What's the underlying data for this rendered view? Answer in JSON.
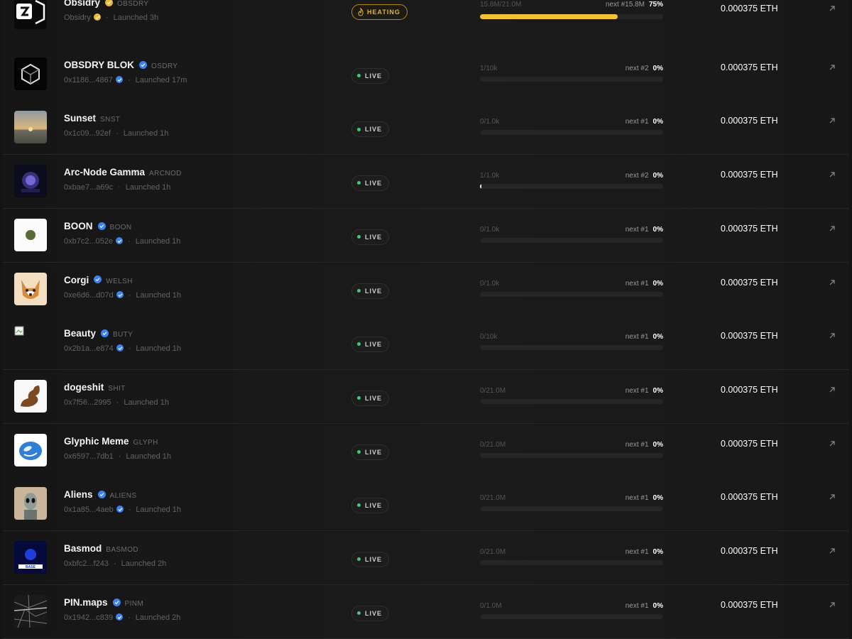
{
  "colors": {
    "live": "#3ecb74",
    "heating": "#e5b530",
    "verified": "#3b82f6",
    "progress": "#f2c233"
  },
  "icons": {
    "verified": "check-badge-icon",
    "open": "arrow-up-right-icon",
    "heating": "flame-icon"
  },
  "tokens": [
    {
      "name": "Obsidry",
      "ticker": "OBSDRY",
      "address": "Obsidry",
      "address_verified": true,
      "launched": "Launched 3h",
      "status": "HEATING",
      "status_kind": "heating",
      "verified": "gold",
      "supply": "15.8M/21.0M",
      "next": "next #15.8M",
      "pct": "75%",
      "progress": 0.75,
      "price": "0.000375 ETH",
      "avatar": "obsidry-logo"
    },
    {
      "name": "OBSDRY BLOK",
      "ticker": "OSDRY",
      "address": "0x1186...4867",
      "address_verified": true,
      "launched": "Launched 17m",
      "status": "LIVE",
      "status_kind": "live",
      "verified": "blue",
      "supply": "1/10k",
      "next": "next #2",
      "pct": "0%",
      "progress": 0,
      "price": "0.000375 ETH",
      "avatar": "cube-logo"
    },
    {
      "name": "Sunset",
      "ticker": "SNST",
      "address": "0x1c09...92ef",
      "address_verified": false,
      "launched": "Launched 1h",
      "status": "LIVE",
      "status_kind": "live",
      "verified": "none",
      "supply": "0/1.0k",
      "next": "next #1",
      "pct": "0%",
      "progress": 0,
      "price": "0.000375 ETH",
      "avatar": "sunset-image"
    },
    {
      "name": "Arc-Node Gamma",
      "ticker": "ARCNOD",
      "address": "0xbae7...a69c",
      "address_verified": false,
      "launched": "Launched 1h",
      "status": "LIVE",
      "status_kind": "live",
      "verified": "none",
      "supply": "1/1.0k",
      "next": "next #2",
      "pct": "0%",
      "progress": 0.001,
      "price": "0.000375 ETH",
      "avatar": "orb-image"
    },
    {
      "name": "BOON",
      "ticker": "BOON",
      "address": "0xb7c2...052e",
      "address_verified": true,
      "launched": "Launched 1h",
      "status": "LIVE",
      "status_kind": "live",
      "verified": "blue",
      "supply": "0/1.0k",
      "next": "next #1",
      "pct": "0%",
      "progress": 0,
      "price": "0.000375 ETH",
      "avatar": "dot-logo"
    },
    {
      "name": "Corgi",
      "ticker": "WELSH",
      "address": "0xe6d6...d07d",
      "address_verified": true,
      "launched": "Launched 1h",
      "status": "LIVE",
      "status_kind": "live",
      "verified": "blue",
      "supply": "0/1.0k",
      "next": "next #1",
      "pct": "0%",
      "progress": 0,
      "price": "0.000375 ETH",
      "avatar": "corgi-image"
    },
    {
      "name": "Beauty",
      "ticker": "BUTY",
      "address": "0x2b1a...e874",
      "address_verified": true,
      "launched": "Launched 1h",
      "status": "LIVE",
      "status_kind": "live",
      "verified": "blue",
      "supply": "0/10k",
      "next": "next #1",
      "pct": "0%",
      "progress": 0,
      "price": "0.000375 ETH",
      "avatar": "broken-image"
    },
    {
      "name": "dogeshit",
      "ticker": "SHIT",
      "address": "0x7f56...2995",
      "address_verified": false,
      "launched": "Launched 1h",
      "status": "LIVE",
      "status_kind": "live",
      "verified": "none",
      "supply": "0/21.0M",
      "next": "next #1",
      "pct": "0%",
      "progress": 0,
      "price": "0.000375 ETH",
      "avatar": "poop-image"
    },
    {
      "name": "Glyphic Meme",
      "ticker": "GLYPH",
      "address": "0x6597...7db1",
      "address_verified": false,
      "launched": "Launched 1h",
      "status": "LIVE",
      "status_kind": "live",
      "verified": "none",
      "supply": "0/21.0M",
      "next": "next #1",
      "pct": "0%",
      "progress": 0,
      "price": "0.000375 ETH",
      "avatar": "glyph-image"
    },
    {
      "name": "Aliens",
      "ticker": "ALIENS",
      "address": "0x1a85...4aeb",
      "address_verified": true,
      "launched": "Launched 1h",
      "status": "LIVE",
      "status_kind": "live",
      "verified": "blue",
      "supply": "0/21.0M",
      "next": "next #1",
      "pct": "0%",
      "progress": 0,
      "price": "0.000375 ETH",
      "avatar": "alien-image"
    },
    {
      "name": "Basmod",
      "ticker": "BASMOD",
      "address": "0xbfc2...f243",
      "address_verified": false,
      "launched": "Launched 2h",
      "status": "LIVE",
      "status_kind": "live",
      "verified": "none",
      "supply": "0/21.0M",
      "next": "next #1",
      "pct": "0%",
      "progress": 0,
      "price": "0.000375 ETH",
      "avatar": "basmod-image"
    },
    {
      "name": "PIN.maps",
      "ticker": "PINM",
      "address": "0x1942...c839",
      "address_verified": true,
      "launched": "Launched 2h",
      "status": "LIVE",
      "status_kind": "live",
      "verified": "blue",
      "supply": "0/1.0M",
      "next": "next #1",
      "pct": "0%",
      "progress": 0,
      "price": "0.000375 ETH",
      "avatar": "map-image"
    }
  ]
}
